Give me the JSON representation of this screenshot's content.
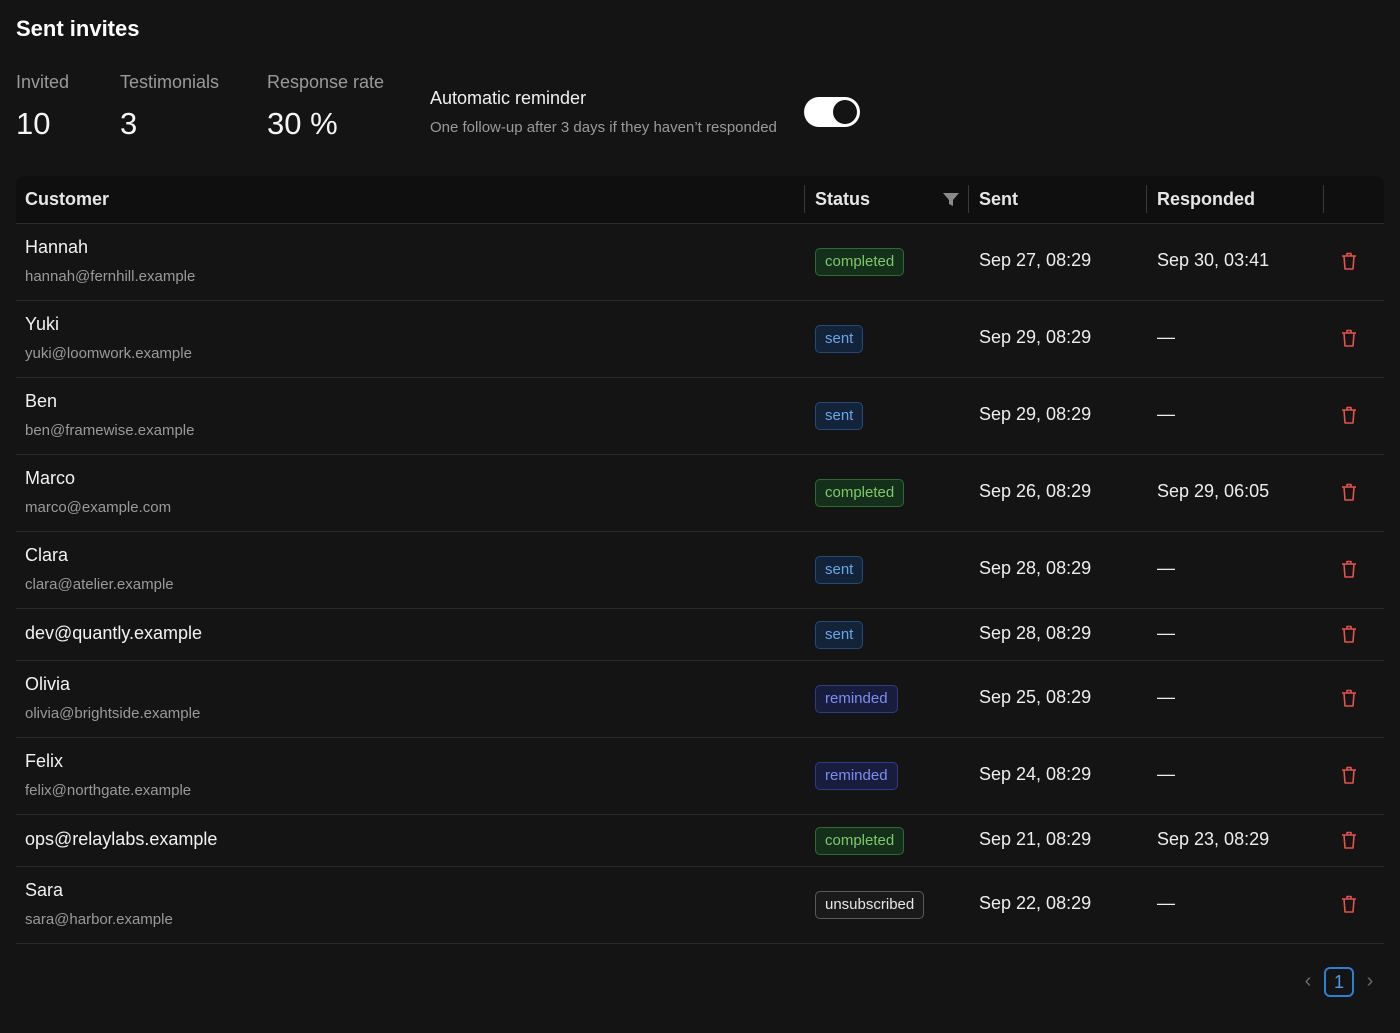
{
  "header": {
    "title": "Sent invites"
  },
  "stats": [
    {
      "label": "Invited",
      "value": "10"
    },
    {
      "label": "Testimonials",
      "value": "3"
    },
    {
      "label": "Response rate",
      "value": "30 %"
    }
  ],
  "reminder": {
    "title": "Automatic reminder",
    "description": "One follow-up after 3 days if they haven’t responded",
    "enabled": true
  },
  "table": {
    "columns": {
      "customer": "Customer",
      "status": "Status",
      "sent": "Sent",
      "responded": "Responded"
    },
    "rows": [
      {
        "name": "Hannah",
        "email": "hannah@fernhill.example",
        "status": "completed",
        "sent": "Sep 27, 08:29",
        "responded": "Sep 30, 03:41"
      },
      {
        "name": "Yuki",
        "email": "yuki@loomwork.example",
        "status": "sent",
        "sent": "Sep 29, 08:29",
        "responded": "—"
      },
      {
        "name": "Ben",
        "email": "ben@framewise.example",
        "status": "sent",
        "sent": "Sep 29, 08:29",
        "responded": "—"
      },
      {
        "name": "Marco",
        "email": "marco@example.com",
        "status": "completed",
        "sent": "Sep 26, 08:29",
        "responded": "Sep 29, 06:05"
      },
      {
        "name": "Clara",
        "email": "clara@atelier.example",
        "status": "sent",
        "sent": "Sep 28, 08:29",
        "responded": "—"
      },
      {
        "name": "",
        "email": "dev@quantly.example",
        "status": "sent",
        "sent": "Sep 28, 08:29",
        "responded": "—"
      },
      {
        "name": "Olivia",
        "email": "olivia@brightside.example",
        "status": "reminded",
        "sent": "Sep 25, 08:29",
        "responded": "—"
      },
      {
        "name": "Felix",
        "email": "felix@northgate.example",
        "status": "reminded",
        "sent": "Sep 24, 08:29",
        "responded": "—"
      },
      {
        "name": "",
        "email": "ops@relaylabs.example",
        "status": "completed",
        "sent": "Sep 21, 08:29",
        "responded": "Sep 23, 08:29"
      },
      {
        "name": "Sara",
        "email": "sara@harbor.example",
        "status": "unsubscribed",
        "sent": "Sep 22, 08:29",
        "responded": "—"
      }
    ]
  },
  "pagination": {
    "current_page": "1"
  },
  "icons": {
    "filter": "filter-icon",
    "delete": "trash-icon",
    "prev": "chevron-left-icon",
    "next": "chevron-right-icon"
  },
  "colors": {
    "completed": "#7ec86a",
    "sent": "#6aa6e8",
    "reminded": "#7f8cf0",
    "delete": "#e5534b",
    "page_accent": "#2f7fd0"
  }
}
